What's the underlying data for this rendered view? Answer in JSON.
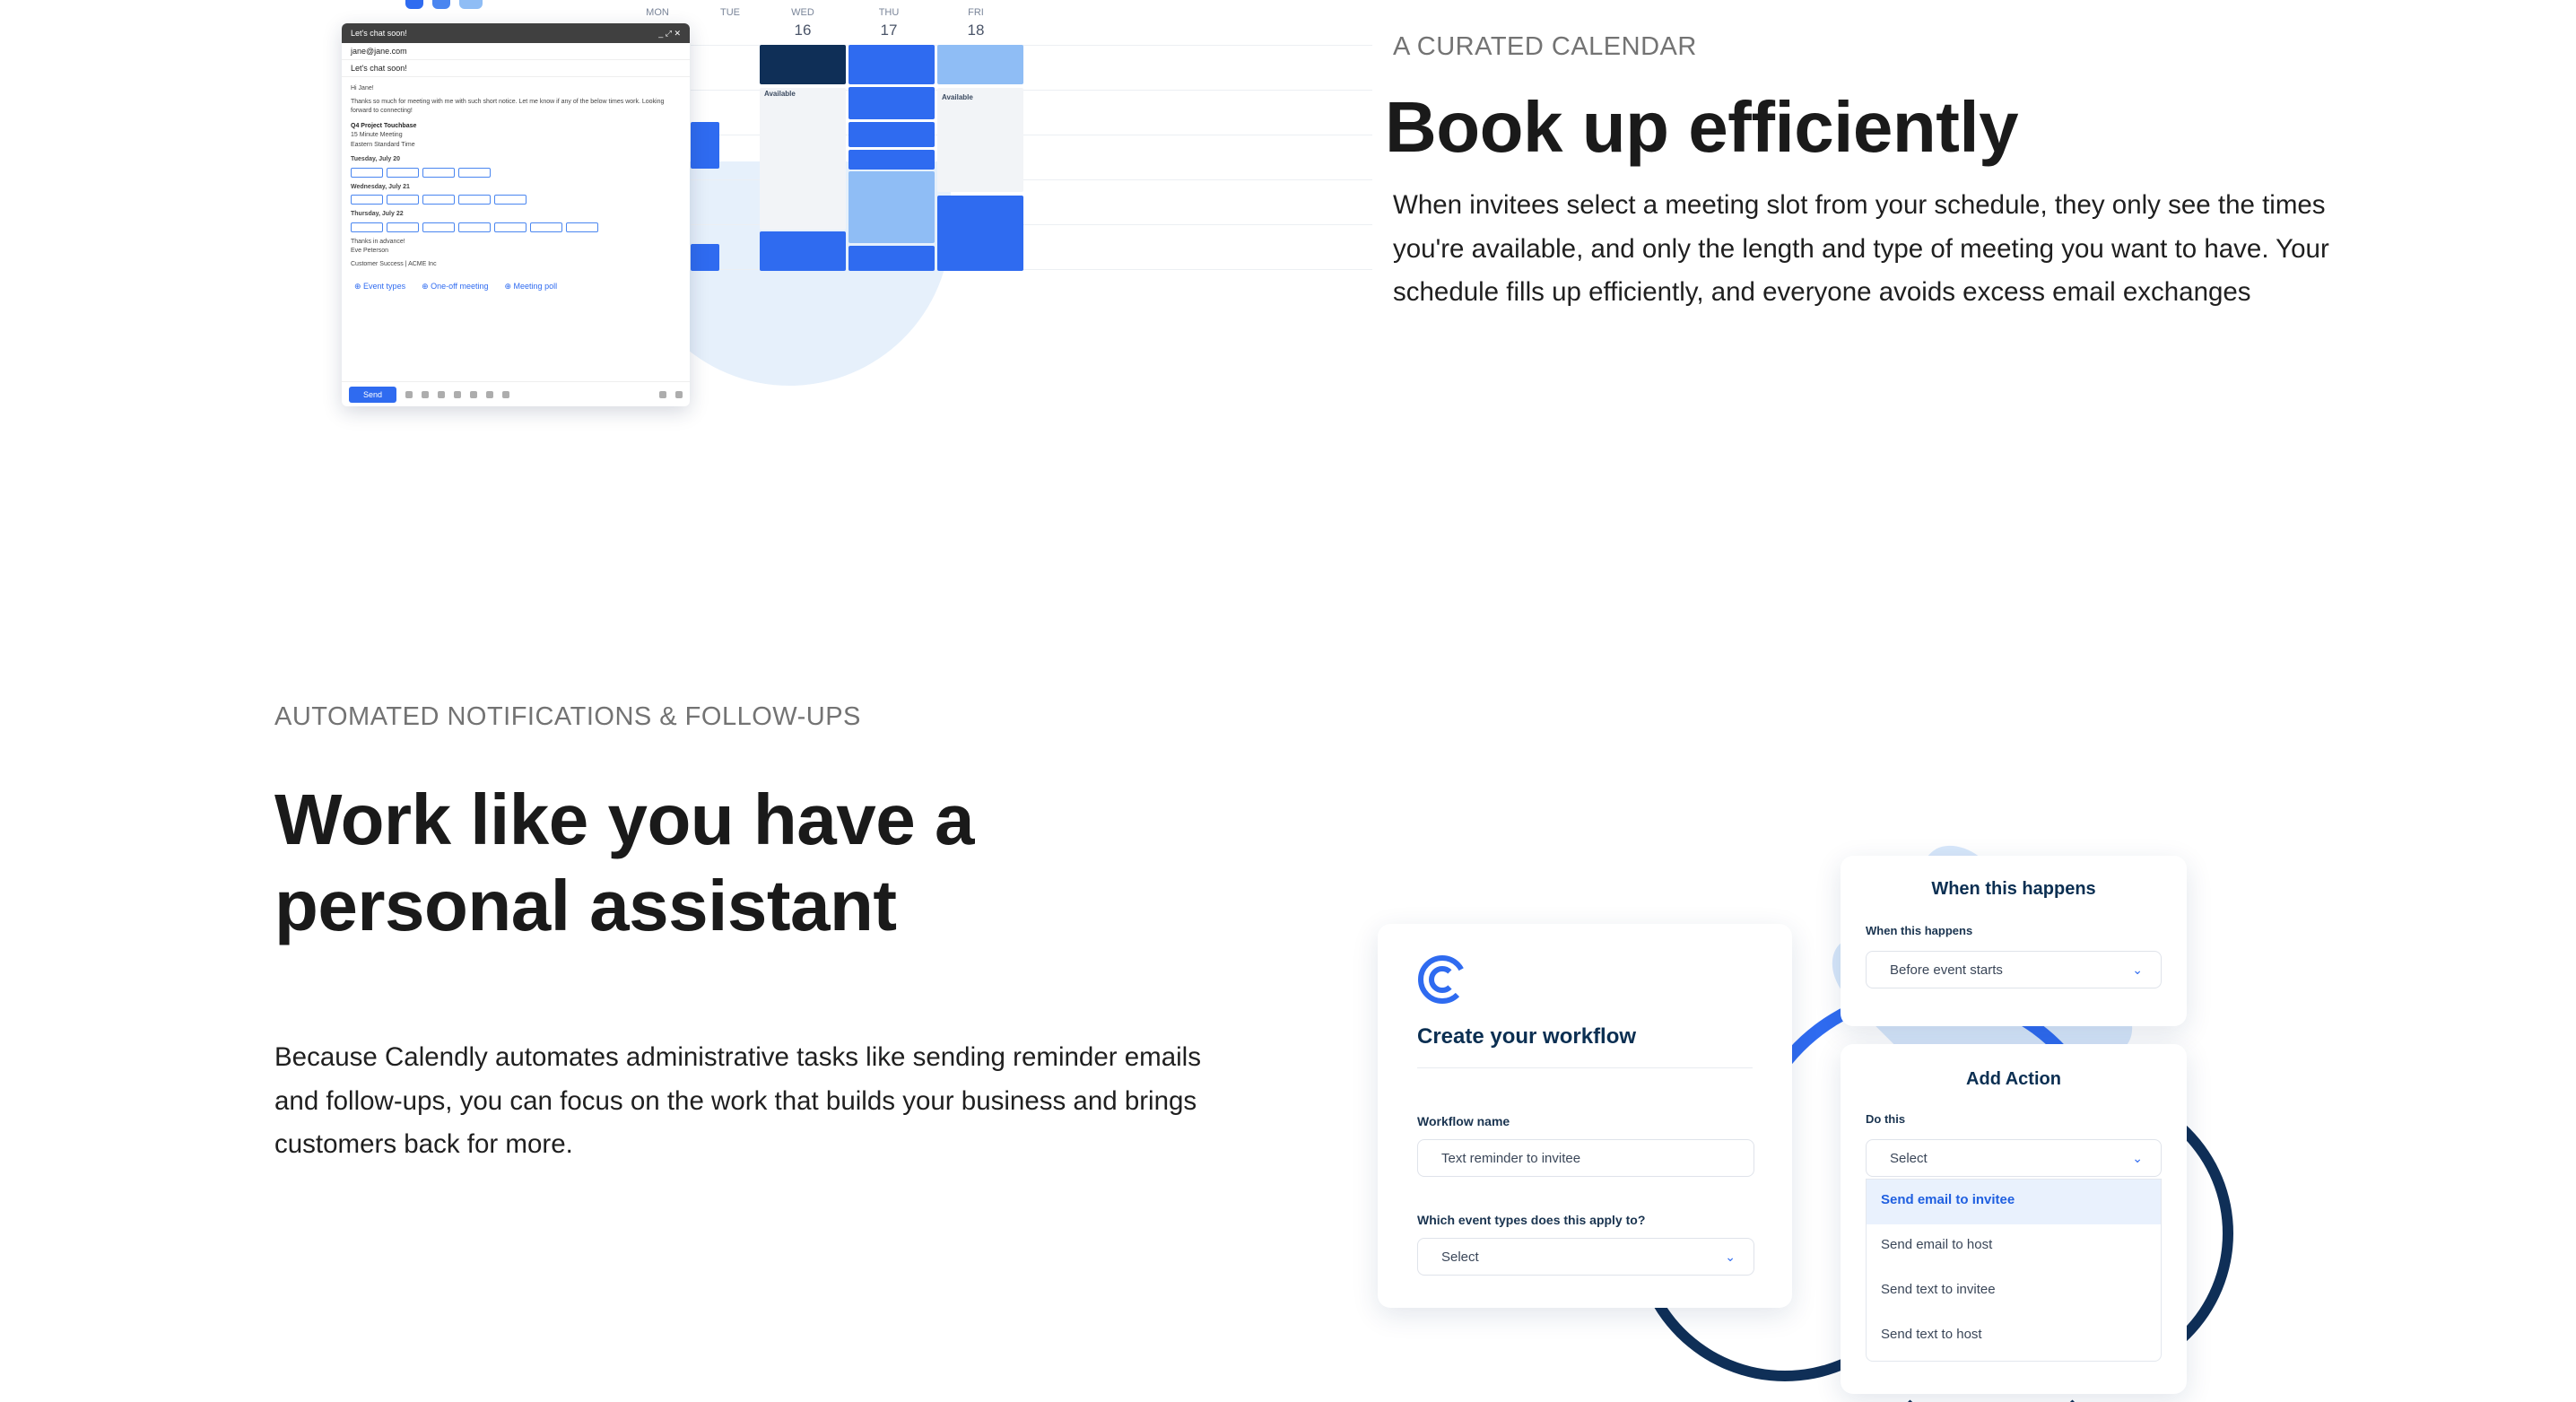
{
  "section_calendar": {
    "eyebrow": "A CURATED CALENDAR",
    "heading": "Book up efficiently",
    "body": "When invitees select a meeting slot from your schedule, they only see the times you're available, and only the length and type of meeting you want to have. Your schedule fills up efficiently, and everyone avoids excess email exchanges"
  },
  "calendar_illustration": {
    "days": [
      {
        "name": "MON",
        "num": ""
      },
      {
        "name": "TUE",
        "num": ""
      },
      {
        "name": "WED",
        "num": "16"
      },
      {
        "name": "THU",
        "num": "17"
      },
      {
        "name": "FRI",
        "num": "18"
      }
    ],
    "available_label": "Available",
    "email": {
      "window_title": "Let's chat soon!",
      "to": "jane@jane.com",
      "subject": "Let's chat soon!",
      "greeting": "Hi Jane!",
      "intro": "Thanks so much for meeting with me with such short notice. Let me know if any of the below times work. Looking forward to connecting!",
      "event_name": "Q4 Project Touchbase",
      "event_meta_1": "15 Minute Meeting",
      "event_meta_2": "Eastern Standard Time",
      "day_1": "Tuesday, July 20",
      "day_2": "Wednesday, July 21",
      "day_3": "Thursday, July 22",
      "signoff_1": "Thanks in advance!",
      "signoff_2": "Eve Peterson",
      "signoff_3": "Customer Success | ACME Inc",
      "tabs": [
        "Event types",
        "One-off meeting",
        "Meeting poll"
      ],
      "send_label": "Send"
    }
  },
  "section_notifications": {
    "eyebrow": "AUTOMATED NOTIFICATIONS & FOLLOW-UPS",
    "heading": "Work like you have a personal assistant",
    "body": "Because Calendly automates administrative tasks like sending reminder emails and follow-ups, you can focus on the work that builds your business and brings customers back for more."
  },
  "workflow_illustration": {
    "create_card": {
      "title": "Create your workflow",
      "name_label": "Workflow name",
      "name_value": "Text reminder to invitee",
      "event_types_label": "Which event types does this apply to?",
      "event_types_value": "Select"
    },
    "trigger_card": {
      "title": "When this happens",
      "label": "When this happens",
      "value": "Before event starts"
    },
    "action_card": {
      "title": "Add Action",
      "label": "Do this",
      "value": "Select",
      "options": [
        "Send email to invitee",
        "Send email to host",
        "Send text to invitee",
        "Send text to host"
      ]
    }
  },
  "colors": {
    "brand_blue": "#2f6bf0",
    "navy": "#0f2f57",
    "light_blue": "#8fbdf5",
    "eyebrow_gray": "#737373"
  }
}
